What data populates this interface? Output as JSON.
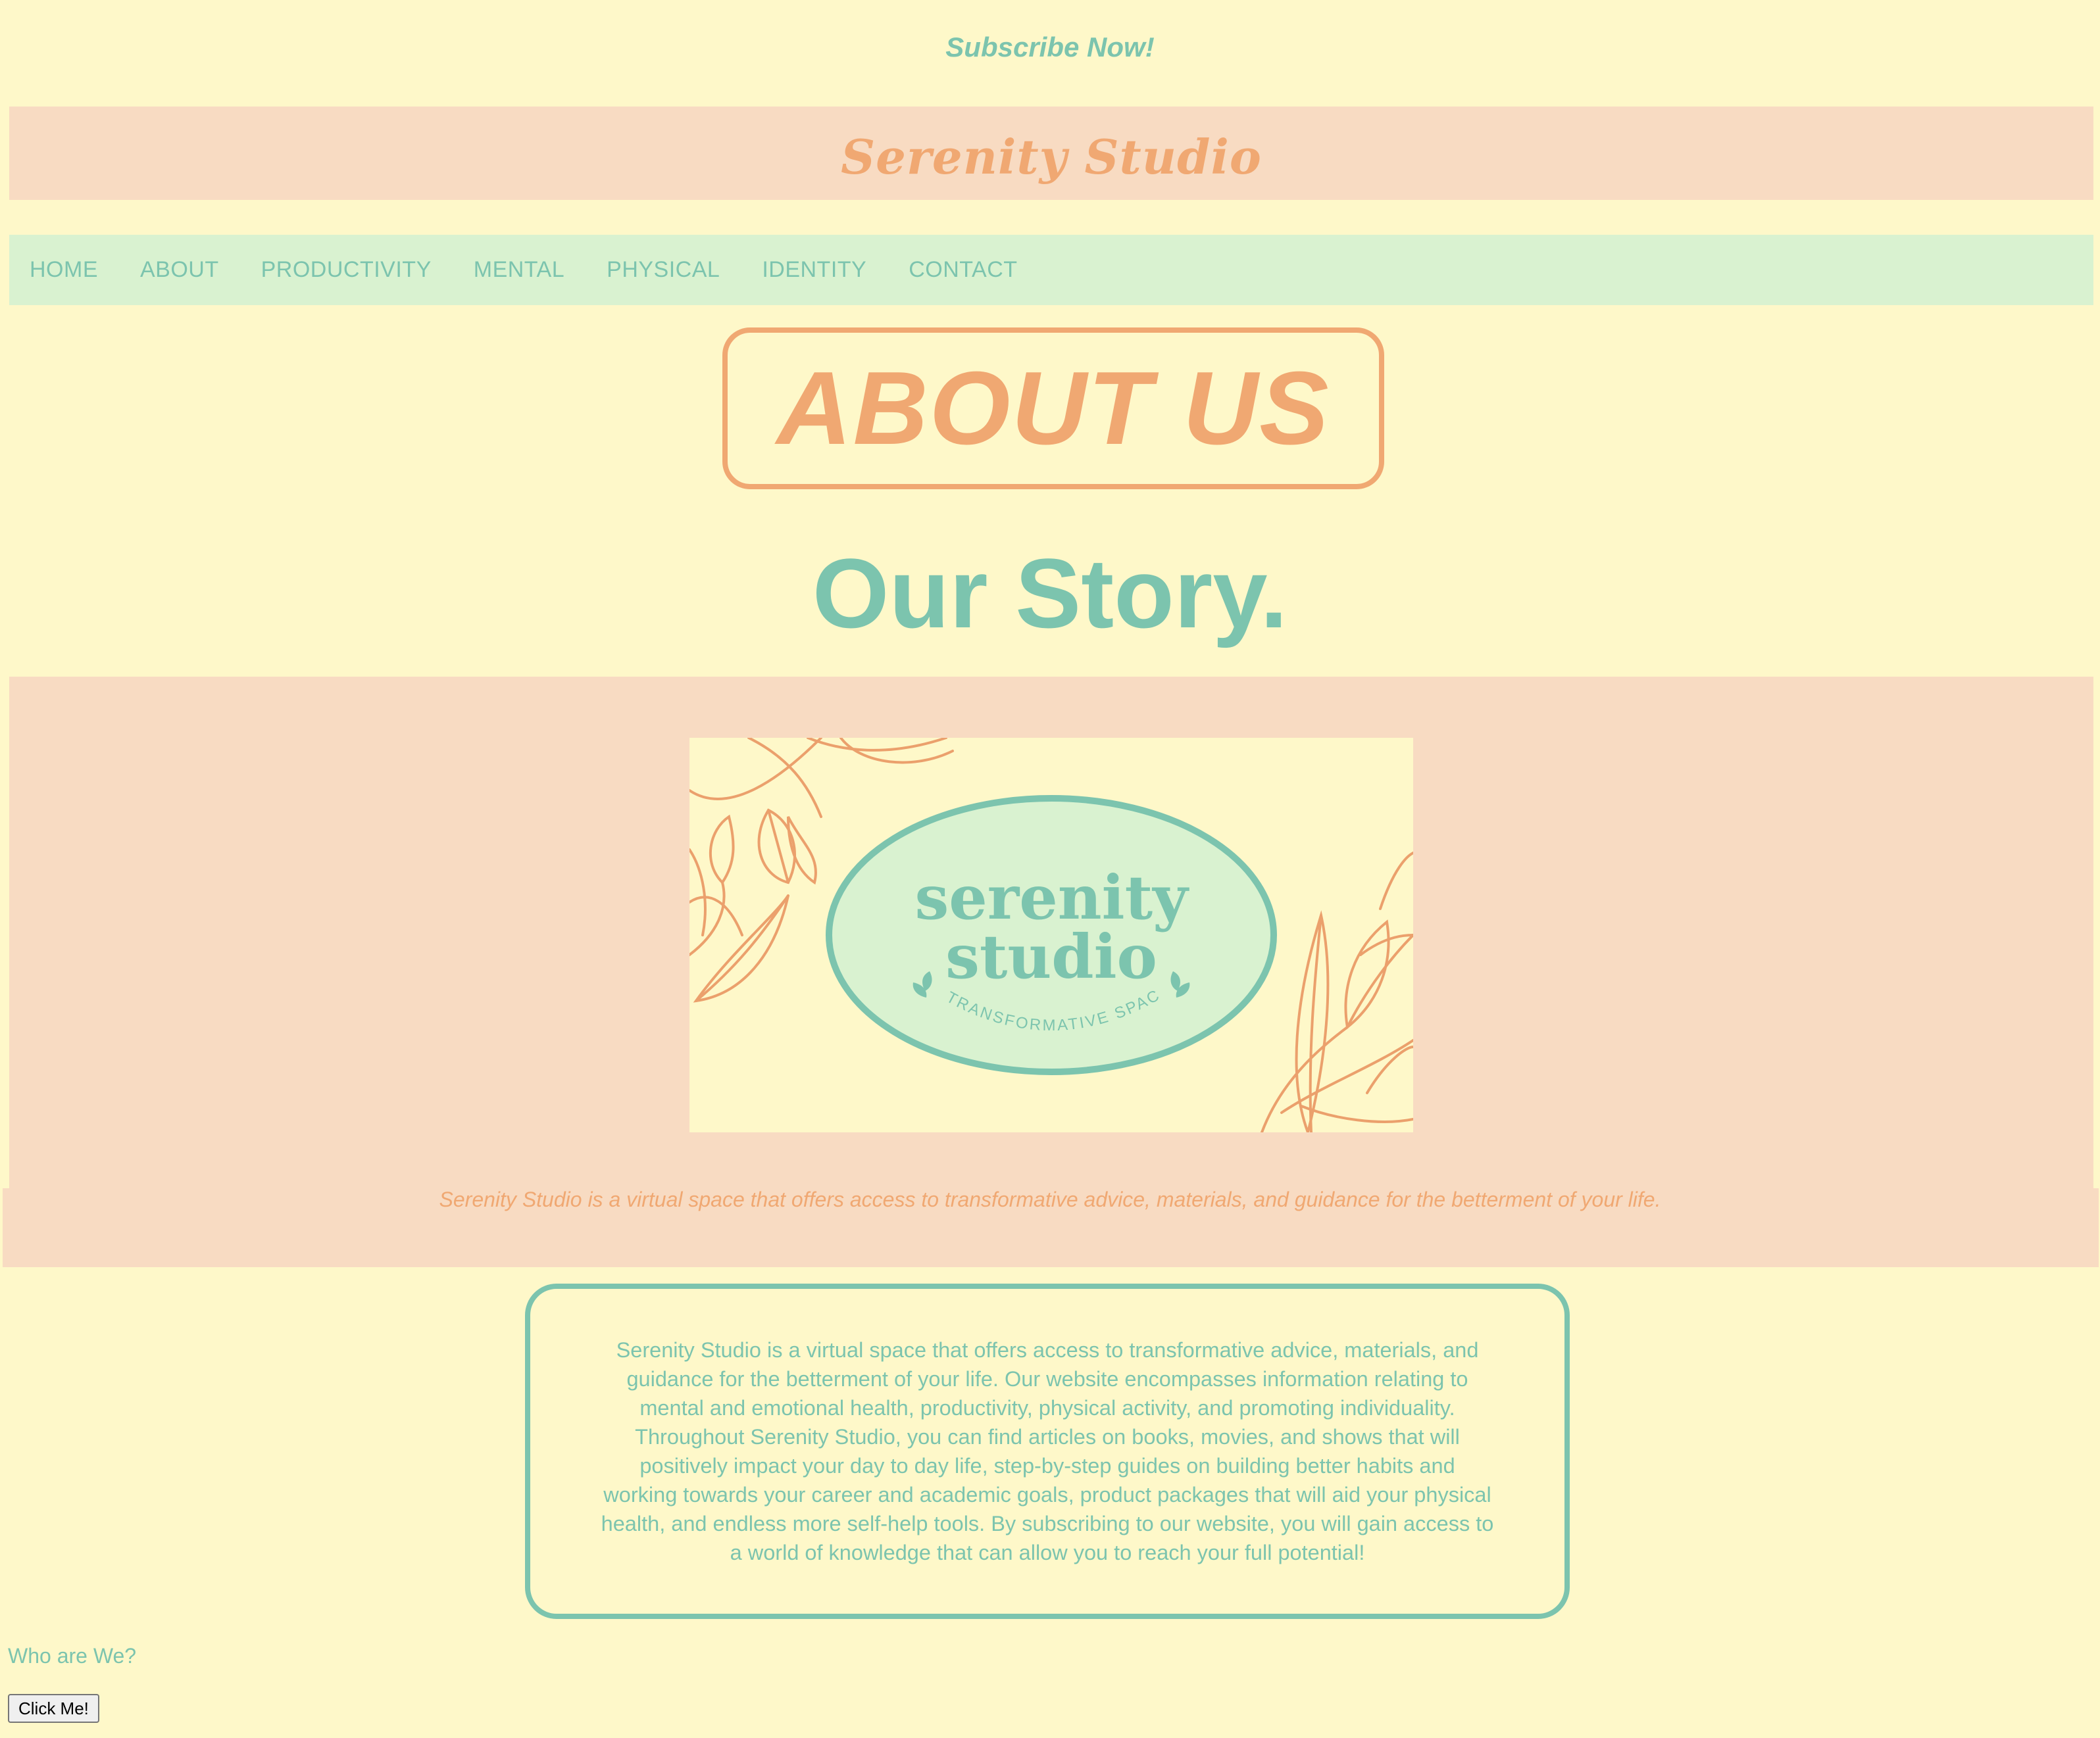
{
  "subscribe": {
    "label": "Subscribe Now!"
  },
  "header": {
    "title": "Serenity Studio"
  },
  "nav": {
    "items": [
      {
        "label": "HOME"
      },
      {
        "label": "ABOUT"
      },
      {
        "label": "PRODUCTIVITY"
      },
      {
        "label": "MENTAL"
      },
      {
        "label": "PHYSICAL"
      },
      {
        "label": "IDENTITY"
      },
      {
        "label": "CONTACT"
      }
    ]
  },
  "about_banner": {
    "text": "ABOUT US"
  },
  "story_heading": {
    "text": "Our Story."
  },
  "logo": {
    "line1": "serenity",
    "line2": "studio",
    "tagline": "A TRANSFORMATIVE SPACE"
  },
  "caption": {
    "text": "Serenity Studio is a virtual space that offers access to transformative advice, materials, and guidance for the betterment of your life."
  },
  "description": {
    "text": "Serenity Studio is a virtual space that offers access to transformative advice, materials, and guidance for the betterment of your life. Our website encompasses information relating to mental and emotional health, productivity, physical activity, and promoting individuality. Throughout Serenity Studio, you can find articles on books, movies, and shows that will positively impact your day to day life, step-by-step guides on building better habits and working towards your career and academic goals, product packages that will aid your physical health, and endless more self-help tools. By subscribing to our website, you will gain access to a world of knowledge that can allow you to reach your full potential!"
  },
  "who": {
    "text": "Who are We?"
  },
  "button": {
    "label": "Click Me!"
  },
  "colors": {
    "background": "#fef8c9",
    "peach": "#f8dbc2",
    "orange": "#f0a872",
    "teal": "#7cc4ae",
    "mint": "#d9f2d0"
  }
}
